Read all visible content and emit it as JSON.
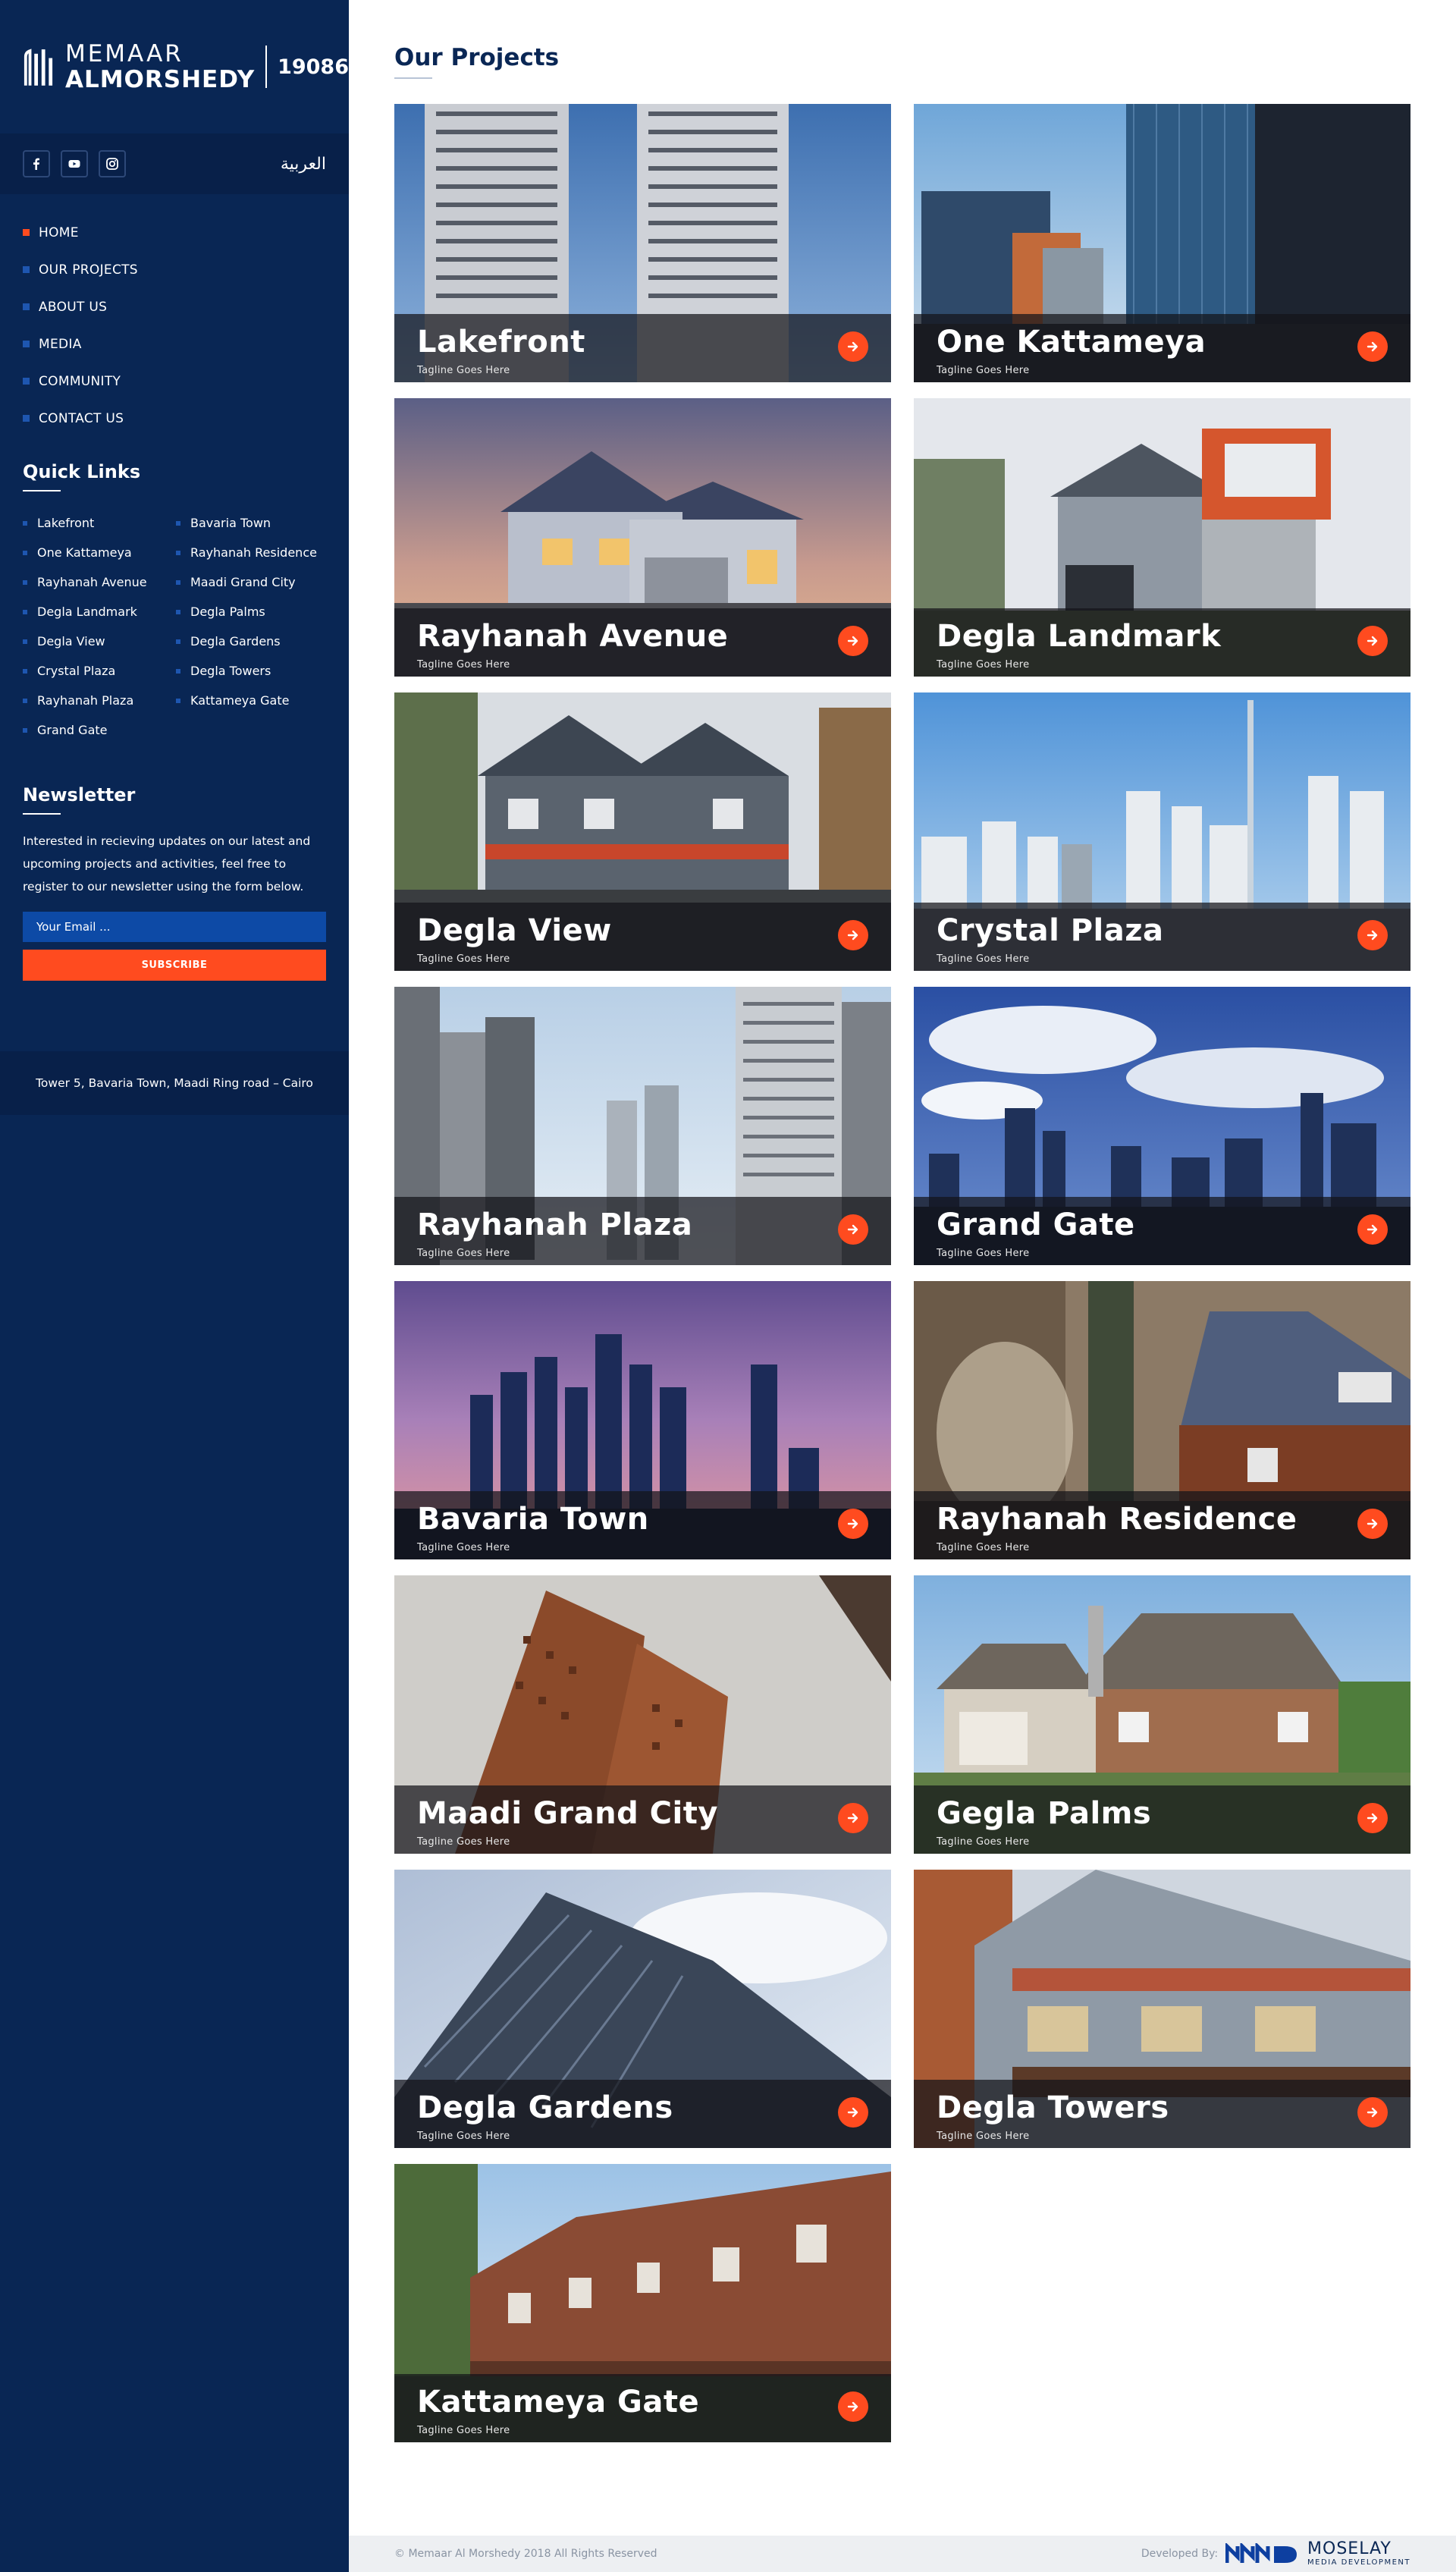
{
  "brand": {
    "line1": "MEMAAR",
    "line2": "ALMORSHEDY",
    "hotline": "19086"
  },
  "social": [
    "facebook-icon",
    "youtube-icon",
    "instagram-icon"
  ],
  "language": "العربية",
  "nav": [
    {
      "label": "HOME",
      "active": true
    },
    {
      "label": "OUR PROJECTS"
    },
    {
      "label": "ABOUT US"
    },
    {
      "label": "MEDIA"
    },
    {
      "label": "COMMUNITY"
    },
    {
      "label": "CONTACT US"
    }
  ],
  "quick_links": {
    "title": "Quick Links",
    "items": [
      "Lakefront",
      "Bavaria Town",
      "One Kattameya",
      "Rayhanah Residence",
      "Rayhanah Avenue",
      "Maadi Grand City",
      "Degla Landmark",
      "Degla Palms",
      "Degla View",
      "Degla Gardens",
      "Crystal Plaza",
      "Degla Towers",
      "Rayhanah Plaza",
      "Kattameya Gate",
      "Grand Gate"
    ]
  },
  "newsletter": {
    "title": "Newsletter",
    "text": "Interested in recieving updates on our latest and upcoming projects and activities, feel free to register to our newsletter using the form below.",
    "placeholder": "Your Email ...",
    "button": "SUBSCRIBE"
  },
  "address": "Tower 5,  Bavaria Town, Maadi Ring road – Cairo",
  "page": {
    "title": "Our Projects"
  },
  "projects": [
    {
      "name": "Lakefront",
      "tagline": "Tagline Goes Here"
    },
    {
      "name": "One Kattameya",
      "tagline": "Tagline Goes Here"
    },
    {
      "name": "Rayhanah Avenue",
      "tagline": "Tagline Goes Here"
    },
    {
      "name": "Degla Landmark",
      "tagline": "Tagline Goes Here"
    },
    {
      "name": "Degla View",
      "tagline": "Tagline Goes Here"
    },
    {
      "name": "Crystal Plaza",
      "tagline": "Tagline Goes Here"
    },
    {
      "name": "Rayhanah Plaza",
      "tagline": "Tagline Goes Here"
    },
    {
      "name": "Grand Gate",
      "tagline": "Tagline Goes Here"
    },
    {
      "name": "Bavaria Town",
      "tagline": "Tagline Goes Here"
    },
    {
      "name": "Rayhanah Residence",
      "tagline": "Tagline Goes Here"
    },
    {
      "name": "Maadi Grand City",
      "tagline": "Tagline Goes Here"
    },
    {
      "name": "Gegla Palms",
      "tagline": "Tagline Goes Here"
    },
    {
      "name": "Degla Gardens",
      "tagline": "Tagline Goes Here"
    },
    {
      "name": "Degla Towers",
      "tagline": "Tagline Goes Here"
    },
    {
      "name": "Kattameya Gate",
      "tagline": "Tagline Goes Here"
    }
  ],
  "footer": {
    "copyright": "© Memaar Al Morshedy 2018 All Rights Reserved",
    "developed_by": "Developed By:",
    "dev_name": "MOSELAY",
    "dev_sub": "MEDIA DEVELOPMENT"
  },
  "colors": {
    "navy": "#092654",
    "accent": "#ff4b1f",
    "nav_bullet": "#1e56b0"
  }
}
